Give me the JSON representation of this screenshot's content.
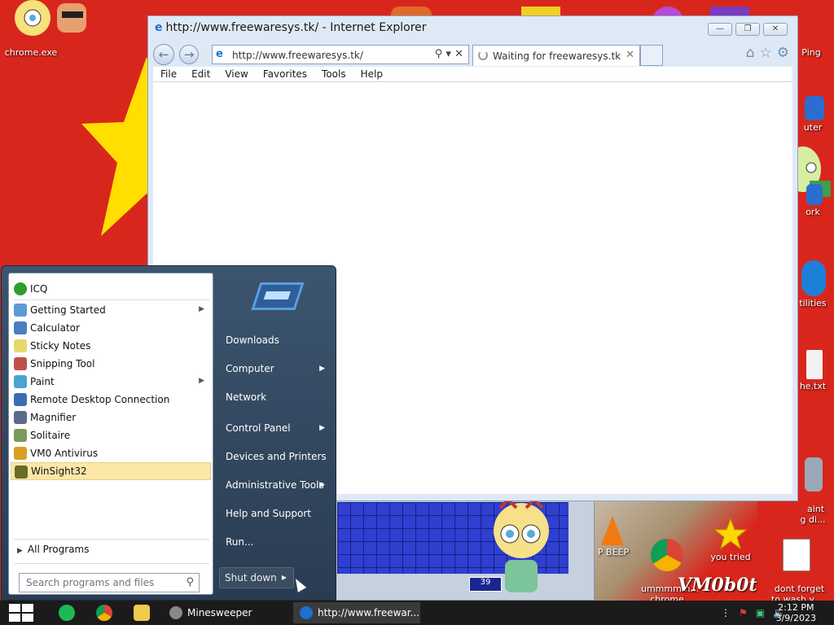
{
  "desktop": {
    "icons": [
      {
        "label": "chrome.exe"
      },
      {
        "label": "Ping"
      },
      {
        "label": "uter"
      },
      {
        "label": "ork"
      },
      {
        "label": "tilities"
      },
      {
        "label": "he.txt"
      },
      {
        "label": "aint\ng di..."
      },
      {
        "label": "P BEEP"
      },
      {
        "label": "ummmmm...\nchrome"
      },
      {
        "label": "you tried"
      },
      {
        "label": "dont forget\nto wash y..."
      }
    ],
    "overlay_text": "VM0b0t",
    "minesweeper_button": "39"
  },
  "ie": {
    "title": "http://www.freewaresys.tk/ - Internet Explorer",
    "address": "http://www.freewaresys.tk/",
    "tab_label": "Waiting for freewaresys.tk",
    "menu": [
      "File",
      "Edit",
      "View",
      "Favorites",
      "Tools",
      "Help"
    ]
  },
  "start_menu": {
    "programs": [
      {
        "label": "ICQ",
        "color": "#2e9e2e",
        "has_arrow": false
      },
      {
        "label": "Getting Started",
        "color": "#5b9bd5",
        "has_arrow": true
      },
      {
        "label": "Calculator",
        "color": "#4a7fc0",
        "has_arrow": false
      },
      {
        "label": "Sticky Notes",
        "color": "#e8d76a",
        "has_arrow": false
      },
      {
        "label": "Snipping Tool",
        "color": "#c0504d",
        "has_arrow": false
      },
      {
        "label": "Paint",
        "color": "#4aa3d0",
        "has_arrow": true
      },
      {
        "label": "Remote Desktop Connection",
        "color": "#3c6db0",
        "has_arrow": false
      },
      {
        "label": "Magnifier",
        "color": "#5a6b8c",
        "has_arrow": false
      },
      {
        "label": "Solitaire",
        "color": "#7a9a5a",
        "has_arrow": false
      },
      {
        "label": "VM0 Antivirus",
        "color": "#d9a020",
        "has_arrow": false
      },
      {
        "label": "WinSight32",
        "color": "#6a6a2a",
        "has_arrow": false
      }
    ],
    "all_programs": "All Programs",
    "search_placeholder": "Search programs and files",
    "right_links": [
      {
        "label": "Downloads",
        "has_arrow": false
      },
      {
        "label": "Computer",
        "has_arrow": true
      },
      {
        "label": "Network",
        "has_arrow": false
      },
      {
        "label": "Control Panel",
        "has_arrow": true
      },
      {
        "label": "Devices and Printers",
        "has_arrow": false
      },
      {
        "label": "Administrative Tools",
        "has_arrow": true
      },
      {
        "label": "Help and Support",
        "has_arrow": false
      },
      {
        "label": "Run...",
        "has_arrow": false
      }
    ],
    "shutdown": "Shut down"
  },
  "taskbar": {
    "tasks": [
      {
        "label": "Minesweeper"
      },
      {
        "label": "http://www.freewar..."
      }
    ],
    "time": "2:12 PM",
    "date": "3/9/2023"
  }
}
